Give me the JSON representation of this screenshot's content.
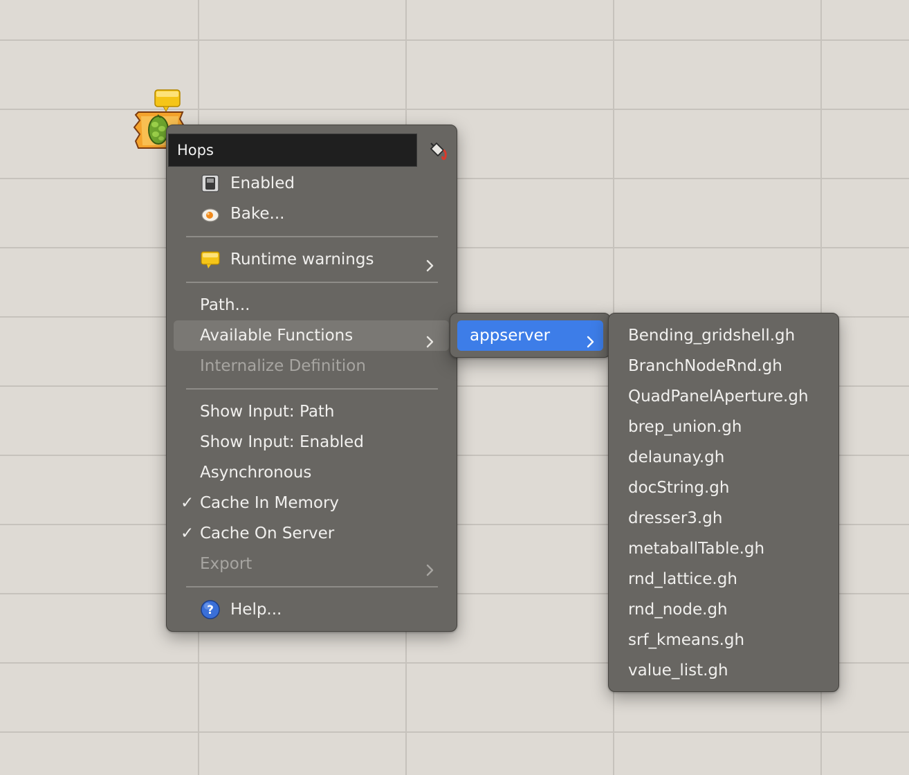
{
  "component": {
    "icon": "hops-component-icon",
    "warning_icon": "speech-bubble-warning-icon"
  },
  "menu": {
    "name_value": "Hops",
    "paint_icon": "paint-bucket-icon",
    "items": {
      "enabled": {
        "label": "Enabled",
        "icon": "switch-icon"
      },
      "bake": {
        "label": "Bake...",
        "icon": "bake-egg-icon"
      },
      "runtime_warnings": {
        "label": "Runtime warnings",
        "icon": "speech-bubble-warning-icon"
      },
      "path": {
        "label": "Path..."
      },
      "available_functions": {
        "label": "Available Functions",
        "highlighted": true
      },
      "internalize_definition": {
        "label": "Internalize Definition",
        "disabled": true
      },
      "show_input_path": {
        "label": "Show Input: Path"
      },
      "show_input_enabled": {
        "label": "Show Input: Enabled"
      },
      "asynchronous": {
        "label": "Asynchronous"
      },
      "cache_in_memory": {
        "label": "Cache In Memory",
        "checked": true
      },
      "cache_on_server": {
        "label": "Cache On Server",
        "checked": true
      },
      "export": {
        "label": "Export",
        "disabled": true
      },
      "help": {
        "label": "Help...",
        "icon": "help-question-icon"
      }
    },
    "check_glyph": "✓"
  },
  "submenu": {
    "label": "appserver"
  },
  "functions": {
    "items": [
      "Bending_gridshell.gh",
      "BranchNodeRnd.gh",
      "QuadPanelAperture.gh",
      "brep_union.gh",
      "delaunay.gh",
      "docString.gh",
      "dresser3.gh",
      "metaballTable.gh",
      "rnd_lattice.gh",
      "rnd_node.gh",
      "srf_kmeans.gh",
      "value_list.gh"
    ]
  },
  "colors": {
    "canvas": "#dedad4",
    "grid_line": "#c6c2bc",
    "menu_bg": "#686662",
    "highlight": "#7a7874",
    "accent_selected": "#3d7de8",
    "text": "#f1f0ee",
    "text_disabled": "#a7a5a1"
  }
}
